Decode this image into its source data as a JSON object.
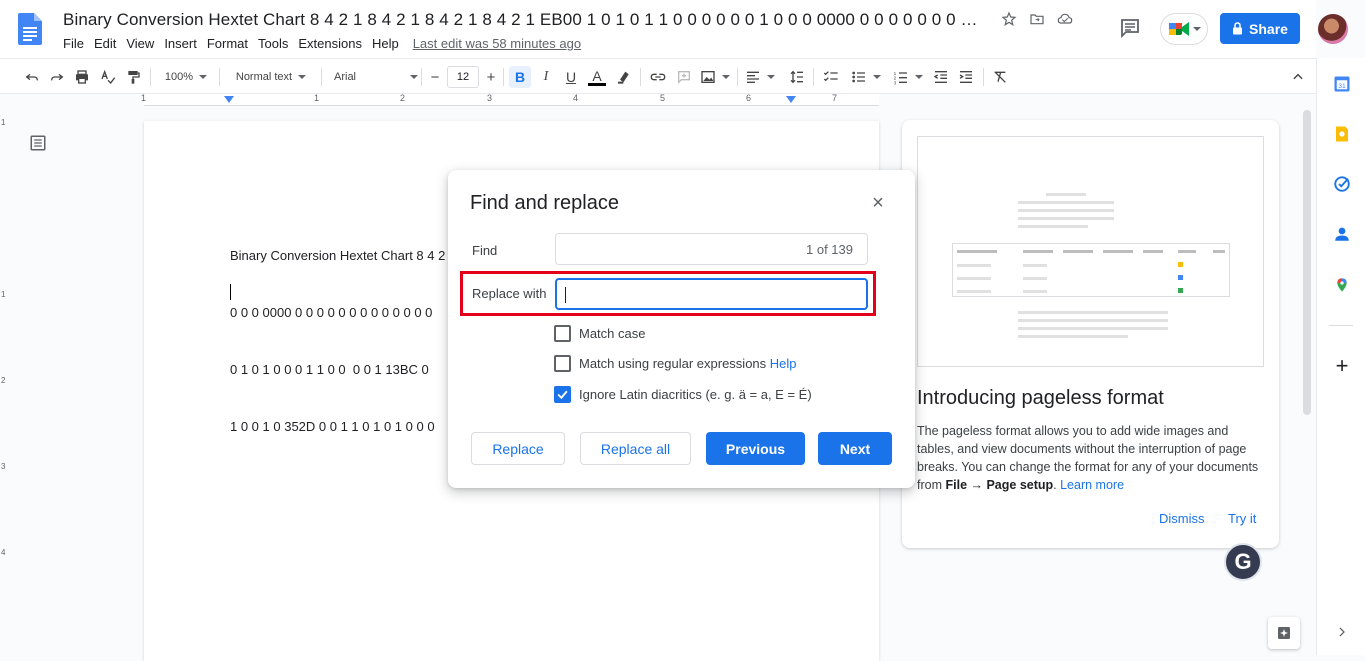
{
  "document": {
    "title": "Binary Conversion Hextet Chart 8 4 2 1 8 4 2 1 8 4 2 1 8 4 2 1 EB00 1 0 1 0 1 1 0 0 0 0 0 0 1  0 0 0 0000 0 0 0 0 0 0 0 0 0 0 0 0 0 ...",
    "last_edit": "Last edit was 58 minutes ago",
    "body_lines": [
      "Binary Conversion Hextet Chart 8 4 2",
      "0 0 0 0000 0 0 0 0 0 0 0 0 0 0 0 0 0",
      "0 1 0 1 0 0 0 1 1 0 0  0 0 1 13BC 0",
      "1 0 0 1 0 352D 0 0 1 1 0 1 0 1 0 0 0"
    ]
  },
  "menu": [
    "File",
    "Edit",
    "View",
    "Insert",
    "Format",
    "Tools",
    "Extensions",
    "Help"
  ],
  "header": {
    "share_label": "Share"
  },
  "toolbar": {
    "zoom": "100%",
    "style": "Normal text",
    "font": "Arial",
    "font_size": "12"
  },
  "ruler": {
    "marks": [
      "1",
      "1",
      "2",
      "3",
      "4",
      "5",
      "6",
      "7"
    ],
    "vertical_marks": [
      "1",
      "1",
      "2",
      "3",
      "4"
    ]
  },
  "find_replace": {
    "title": "Find and replace",
    "find_label": "Find",
    "find_value": "",
    "find_count": "1 of 139",
    "replace_label": "Replace with",
    "replace_value": "",
    "options": [
      {
        "label": "Match case",
        "checked": false
      },
      {
        "label": "Match using regular expressions",
        "checked": false,
        "link": "Help"
      },
      {
        "label": "Ignore Latin diacritics (e. g. ä = a, E = É)",
        "checked": true
      }
    ],
    "buttons": {
      "replace": "Replace",
      "replace_all": "Replace all",
      "previous": "Previous",
      "next": "Next"
    }
  },
  "pageless_card": {
    "title": "Introducing pageless format",
    "body_1": "The pageless format allows you to add wide images and tables, and view documents without the interruption of page breaks. You can change the format for any of your documents from ",
    "body_bold": "File → Page setup",
    "body_2": ". ",
    "learn_more": "Learn more",
    "dismiss": "Dismiss",
    "try_it": "Try it"
  },
  "colors": {
    "accent": "#1a73e8",
    "highlight_box": "#e4001b",
    "text_highlight": "#c7e5c1"
  }
}
